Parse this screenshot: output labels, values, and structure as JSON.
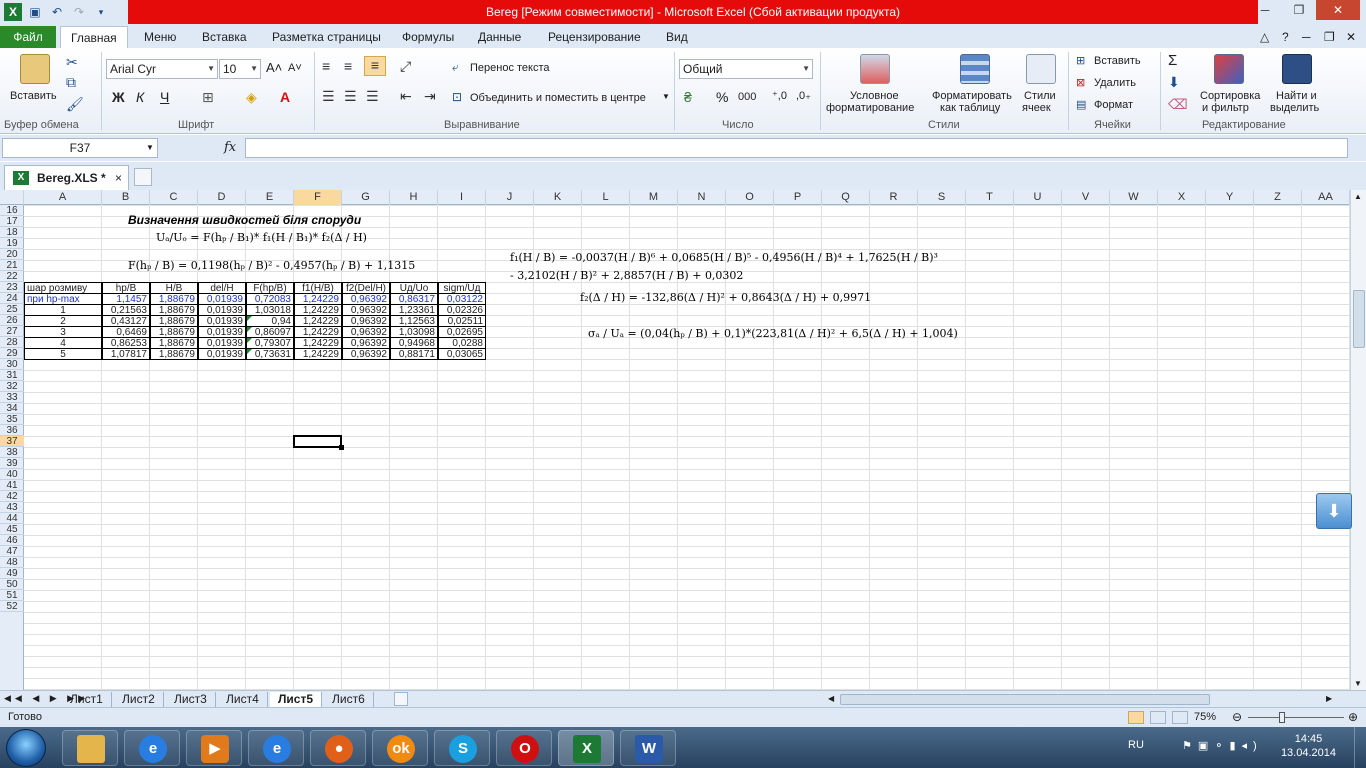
{
  "window": {
    "title": "Bereg  [Режим совместимости]  -  Microsoft Excel (Сбой активации продукта)"
  },
  "ribbon_tabs": [
    "Файл",
    "Главная",
    "Меню",
    "Вставка",
    "Разметка страницы",
    "Формулы",
    "Данные",
    "Рецензирование",
    "Вид"
  ],
  "ribbon": {
    "groups": [
      "Буфер обмена",
      "Шрифт",
      "Выравнивание",
      "Число",
      "Стили",
      "Ячейки",
      "Редактирование"
    ],
    "paste_label": "Вставить",
    "font_name": "Arial Cyr",
    "font_size": "10",
    "wrap_text": "Перенос текста",
    "merge_center": "Объединить и поместить в центре",
    "number_format": "Общий",
    "cond_format_1": "Условное",
    "cond_format_2": "форматирование",
    "format_table_1": "Форматировать",
    "format_table_2": "как таблицу",
    "cell_styles_1": "Стили",
    "cell_styles_2": "ячеек",
    "insert": "Вставить",
    "delete": "Удалить",
    "format": "Формат",
    "sort_1": "Сортировка",
    "sort_2": "и фильтр",
    "find_1": "Найти и",
    "find_2": "выделить",
    "bold": "Ж",
    "italic": "К",
    "underline": "Ч",
    "percent": "%",
    "thousands": "000",
    "sum": "Σ"
  },
  "formula_bar": {
    "name_box": "F37",
    "fx": "fx",
    "value": ""
  },
  "workbook_tab": {
    "name": "Bereg.XLS *",
    "close": "×"
  },
  "columns": [
    "A",
    "B",
    "C",
    "D",
    "E",
    "F",
    "G",
    "H",
    "I",
    "J",
    "K",
    "L",
    "M",
    "N",
    "O",
    "P",
    "Q",
    "R",
    "S",
    "T",
    "U",
    "V",
    "W",
    "X",
    "Y",
    "Z",
    "AA"
  ],
  "rows": [
    "16",
    "17",
    "18",
    "19",
    "20",
    "21",
    "22",
    "23",
    "24",
    "25",
    "26",
    "27",
    "28",
    "29",
    "30",
    "31",
    "32",
    "33",
    "34",
    "35",
    "36",
    "37",
    "38",
    "39",
    "40",
    "41",
    "42",
    "43",
    "44",
    "45",
    "46",
    "47",
    "48",
    "49",
    "50",
    "51",
    "52"
  ],
  "selected": {
    "column": "F",
    "row": "37"
  },
  "sheet": {
    "title": "Визначення швидкостей біля споруди",
    "formula_main": "Uₐ/Uₒ = F(hₚ / B₁)* f₁(H / B₁)* f₂(Δ / H)",
    "formula_F": "F(hₚ / B) = 0,1198(hₚ / B)² - 0,4957(hₚ / B) + 1,1315",
    "formula_f1_line1": "f₁(H / B) = -0,0037(H / B)⁶ + 0,0685(H / B)⁵ - 0,4956(H / B)⁴ + 1,7625(H / B)³",
    "formula_f1_line2": "- 3,2102(H / B)² + 2,8857(H / B) + 0,0302",
    "formula_f2": "f₂(Δ / H) = -132,86(Δ / H)² + 0,8643(Δ / H) + 0,9971",
    "formula_sigma": "σₐ / Uₐ = (0,04(hₚ / B) + 0,1)*(223,81(Δ / H)² + 6,5(Δ / H) + 1,004)",
    "table": {
      "headers": [
        "шар розмиву",
        "hp/B",
        "H/B",
        "del/H",
        "F(hp/B)",
        "f1(H/B)",
        "f2(Del/H)",
        "Uд/Uo",
        "sigm/Uд"
      ],
      "rows": [
        [
          "при hp-max",
          "1,1457",
          "1,88679",
          "0,01939",
          "0,72083",
          "1,24229",
          "0,96392",
          "0,86317",
          "0,03122"
        ],
        [
          "1",
          "0,21563",
          "1,88679",
          "0,01939",
          "1,03018",
          "1,24229",
          "0,96392",
          "1,23361",
          "0,02326"
        ],
        [
          "2",
          "0,43127",
          "1,88679",
          "0,01939",
          "0,94",
          "1,24229",
          "0,96392",
          "1,12563",
          "0,02511"
        ],
        [
          "3",
          "0,6469",
          "1,88679",
          "0,01939",
          "0,86097",
          "1,24229",
          "0,96392",
          "1,03098",
          "0,02695"
        ],
        [
          "4",
          "0,86253",
          "1,88679",
          "0,01939",
          "0,79307",
          "1,24229",
          "0,96392",
          "0,94968",
          "0,0288"
        ],
        [
          "5",
          "1,07817",
          "1,88679",
          "0,01939",
          "0,73631",
          "1,24229",
          "0,96392",
          "0,88171",
          "0,03065"
        ]
      ]
    }
  },
  "sheet_tabs": [
    "Лист1",
    "Лист2",
    "Лист3",
    "Лист4",
    "Лист5",
    "Лист6"
  ],
  "active_sheet": "Лист5",
  "status": {
    "ready": "Готово",
    "zoom": "75%"
  },
  "taskbar": {
    "lang": "RU",
    "time": "14:45",
    "date": "13.04.2014"
  },
  "colors": {
    "accent_red": "#e60b0b",
    "file_tab": "#2a8a2a",
    "blue_text": "#1a2fd6",
    "selection": "#f9d99f"
  }
}
